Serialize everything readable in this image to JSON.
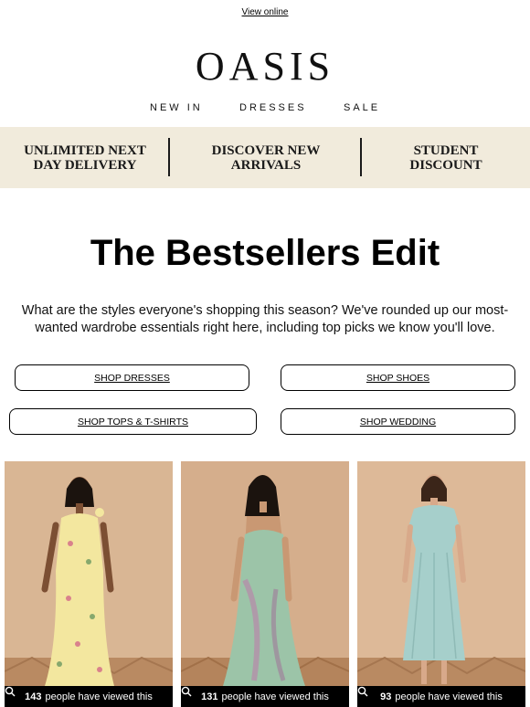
{
  "header": {
    "view_online": "View online",
    "logo": "OASIS",
    "nav": [
      "NEW IN",
      "DRESSES",
      "SALE"
    ]
  },
  "banner": {
    "items": [
      {
        "line1": "UNLIMITED NEXT",
        "line2": "DAY DELIVERY"
      },
      {
        "line1": "DISCOVER NEW",
        "line2": "ARRIVALS"
      },
      {
        "line1": "STUDENT",
        "line2": "DISCOUNT"
      }
    ]
  },
  "main": {
    "title": "The Bestsellers Edit",
    "intro": "What are the styles everyone's shopping this season? We've rounded up our most-wanted wardrobe essentials right here, including top picks we know you'll love.",
    "buttons": [
      "SHOP DRESSES",
      "SHOP SHOES",
      "SHOP TOPS & T-SHIRTS",
      "SHOP WEDDING"
    ]
  },
  "products": [
    {
      "views": "143",
      "views_text": "people have viewed this",
      "icon": "search-icon",
      "dress_color": "#f3e79f"
    },
    {
      "views": "131",
      "views_text": "people have viewed this",
      "icon": "search-icon",
      "dress_color": "#9cc4a8"
    },
    {
      "views": "93",
      "views_text": "people have viewed this",
      "icon": "search-icon",
      "dress_color": "#a6cfcb"
    }
  ]
}
